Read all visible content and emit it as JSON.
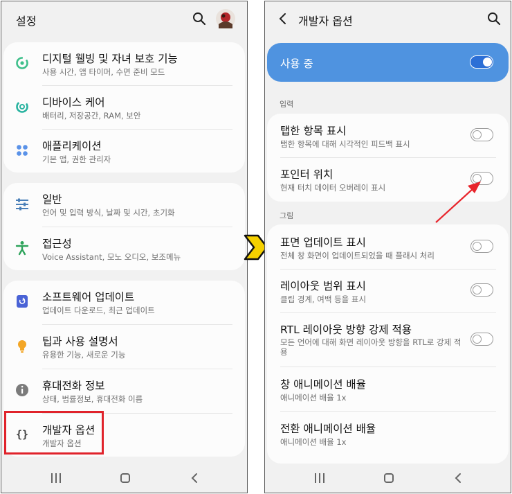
{
  "left_screen": {
    "title": "설정",
    "groups": [
      [
        {
          "title": "디지털 웰빙 및 자녀 보호 기능",
          "subtitle": "사용 시간, 앱 타이머, 수면 준비 모드",
          "icon": "digital-wellbeing-icon"
        },
        {
          "title": "디바이스 케어",
          "subtitle": "배터리, 저장공간, RAM, 보안",
          "icon": "device-care-icon"
        },
        {
          "title": "애플리케이션",
          "subtitle": "기본 앱, 권한 관리자",
          "icon": "apps-icon"
        }
      ],
      [
        {
          "title": "일반",
          "subtitle": "언어 및 입력 방식, 날짜 및 시간, 초기화",
          "icon": "sliders-icon"
        },
        {
          "title": "접근성",
          "subtitle": "Voice Assistant, 모노 오디오, 보조메뉴",
          "icon": "accessibility-icon"
        }
      ],
      [
        {
          "title": "소프트웨어 업데이트",
          "subtitle": "업데이트 다운로드, 최근 업데이트",
          "icon": "software-update-icon"
        },
        {
          "title": "팁과 사용 설명서",
          "subtitle": "유용한 기능, 새로운 기능",
          "icon": "lightbulb-icon"
        },
        {
          "title": "휴대전화 정보",
          "subtitle": "상태, 법률정보, 휴대전화 이름",
          "icon": "info-icon"
        },
        {
          "title": "개발자 옵션",
          "subtitle": "개발자 옵션",
          "icon": "braces-icon"
        }
      ]
    ]
  },
  "right_screen": {
    "title": "개발자 옵션",
    "master_toggle": {
      "label": "사용 중",
      "on": true
    },
    "sections": [
      {
        "label": "입력",
        "items": [
          {
            "title": "탭한 항목 표시",
            "subtitle": "탭한 항목에 대해 시각적인 피드백 표시",
            "on": false
          },
          {
            "title": "포인터 위치",
            "subtitle": "현재 터치 데이터 오버레이 표시",
            "on": false
          }
        ]
      },
      {
        "label": "그림",
        "items": [
          {
            "title": "표면 업데이트 표시",
            "subtitle": "전체 창 화면이 업데이트되었을 때 플래시 처리",
            "on": false
          },
          {
            "title": "레이아웃 범위 표시",
            "subtitle": "클립 경계, 여백 등을 표시",
            "on": false
          },
          {
            "title": "RTL 레이아웃 방향 강제 적용",
            "subtitle": "모든 언어에 대해 화면 레이아웃 방향을 RTL로 강제 적용",
            "on": false
          },
          {
            "title": "창 애니메이션 배율",
            "subtitle": "애니메이션 배율 1x"
          },
          {
            "title": "전환 애니메이션 배율",
            "subtitle": "애니메이션 배율 1x"
          }
        ]
      }
    ]
  },
  "colors": {
    "accent": "#4f93e0",
    "highlight": "#e0232b",
    "arrow": "#f5d000"
  }
}
